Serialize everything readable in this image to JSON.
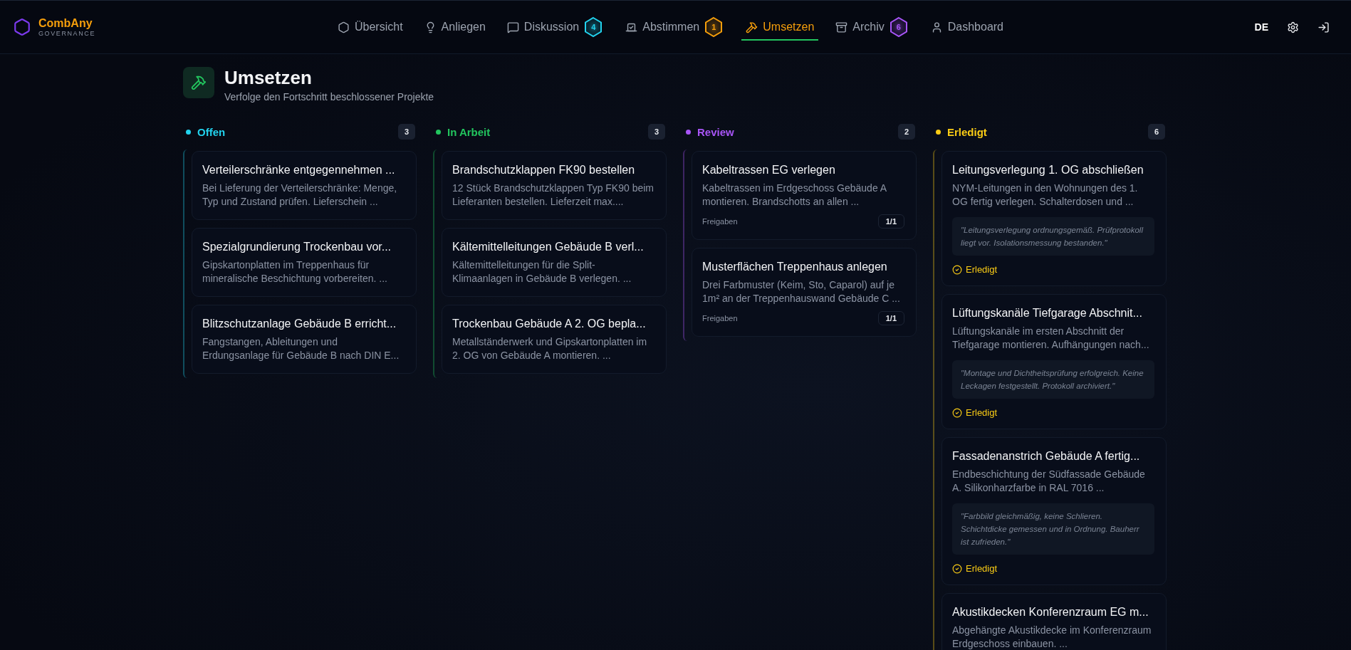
{
  "brand": {
    "name": "CombAny",
    "subtitle": "GOVERNANCE"
  },
  "nav": [
    {
      "label": "Übersicht",
      "selected": false
    },
    {
      "label": "Anliegen",
      "selected": false
    },
    {
      "label": "Diskussion",
      "selected": false,
      "badge": "4",
      "color": "#22d3ee"
    },
    {
      "label": "Abstimmen",
      "selected": false,
      "badge": "1",
      "color": "#f59e0b"
    },
    {
      "label": "Umsetzen",
      "selected": true
    },
    {
      "label": "Archiv",
      "selected": false,
      "badge": "6",
      "color": "#a855f7"
    },
    {
      "label": "Dashboard",
      "selected": false
    }
  ],
  "language": "DE",
  "page": {
    "title": "Umsetzen",
    "subtitle": "Verfolge den Fortschritt beschlossener Projekte"
  },
  "columns": [
    {
      "title": "Offen",
      "count": "3",
      "color": "#22d3ee",
      "cards": [
        {
          "kind": "plain",
          "title": "Verteilerschränke entgegennehmen ...",
          "description": "Bei Lieferung der Verteilerschränke: Menge, Typ und Zustand prüfen. Lieferschein ..."
        },
        {
          "kind": "plain",
          "title": "Spezialgrundierung Trockenbau vor...",
          "description": "Gipskartonplatten im Treppenhaus für mineralische Beschichtung vorbereiten. ..."
        },
        {
          "kind": "plain",
          "title": "Blitzschutzanlage Gebäude B erricht...",
          "description": "Fangstangen, Ableitungen und Erdungsanlage für Gebäude B nach DIN E..."
        }
      ]
    },
    {
      "title": "In Arbeit",
      "count": "3",
      "color": "#22c55e",
      "cards": [
        {
          "kind": "plain",
          "title": "Brandschutzklappen FK90 bestellen",
          "description": "12 Stück Brandschutzklappen Typ FK90 beim Lieferanten bestellen. Lieferzeit max...."
        },
        {
          "kind": "plain",
          "title": "Kältemittelleitungen Gebäude B verl...",
          "description": "Kältemittelleitungen für die Split-Klimaanlagen in Gebäude B verlegen. ..."
        },
        {
          "kind": "plain",
          "title": "Trockenbau Gebäude A 2. OG bepla...",
          "description": "Metallständerwerk und Gipskartonplatten im 2. OG von Gebäude A montieren. ..."
        }
      ]
    },
    {
      "title": "Review",
      "count": "2",
      "color": "#a855f7",
      "cards": [
        {
          "kind": "review",
          "title": "Kabeltrassen EG verlegen",
          "description": "Kabeltrassen im Erdgeschoss Gebäude A montieren. Brandschotts an allen ...",
          "approvals_label": "Freigaben",
          "approvals": "1/1"
        },
        {
          "kind": "review",
          "title": "Musterflächen Treppenhaus anlegen",
          "description": "Drei Farbmuster (Keim, Sto, Caparol) auf je 1m² an der Treppenhauswand Gebäude C ...",
          "approvals_label": "Freigaben",
          "approvals": "1/1"
        }
      ]
    },
    {
      "title": "Erledigt",
      "count": "6",
      "color": "#facc15",
      "cards": [
        {
          "kind": "done",
          "title": "Leitungsverlegung 1. OG abschließen",
          "description": "NYM-Leitungen in den Wohnungen des 1. OG fertig verlegen. Schalterdosen und ...",
          "quote": "\"Leitungsverlegung ordnungsgemäß. Prüfprotokoll liegt vor. Isolationsmessung bestanden.\"",
          "status": "Erledigt"
        },
        {
          "kind": "done",
          "title": "Lüftungskanäle Tiefgarage Abschnit...",
          "description": "Lüftungskanäle im ersten Abschnitt der Tiefgarage montieren. Aufhängungen nach...",
          "quote": "\"Montage und Dichtheitsprüfung erfolgreich. Keine Leckagen festgestellt. Protokoll archiviert.\"",
          "status": "Erledigt"
        },
        {
          "kind": "done",
          "title": "Fassadenanstrich Gebäude A fertig...",
          "description": "Endbeschichtung der Südfassade Gebäude A. Silikonharzfarbe in RAL 7016 ...",
          "quote": "\"Farbbild gleichmäßig, keine Schlieren. Schichtdicke gemessen und in Ordnung. Bauherr ist zufrieden.\"",
          "status": "Erledigt"
        },
        {
          "kind": "plain",
          "title": "Akustikdecken Konferenzraum EG m...",
          "description": "Abgehängte Akustikdecke im Konferenzraum Erdgeschoss einbauen. ..."
        }
      ]
    }
  ]
}
